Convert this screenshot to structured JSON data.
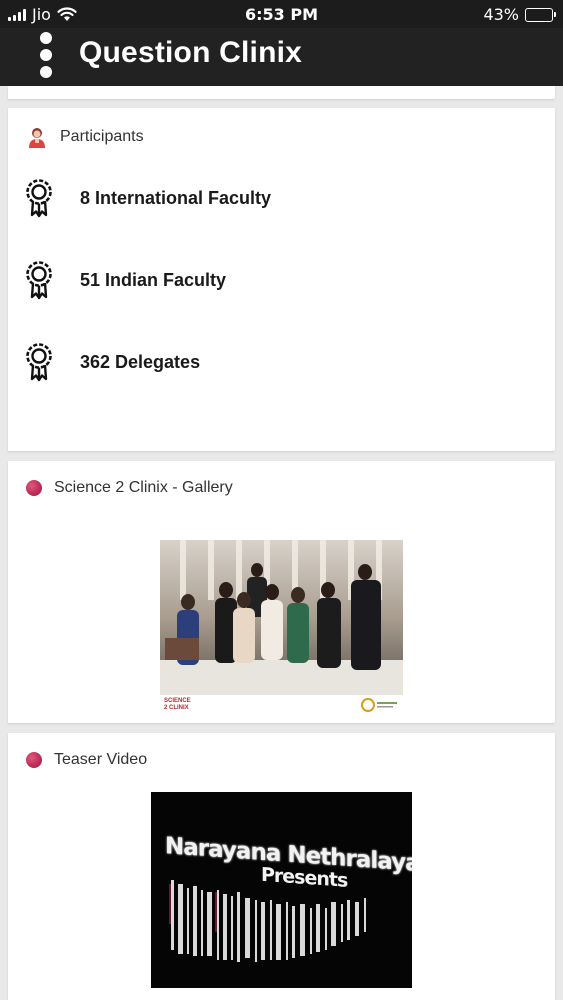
{
  "status_bar": {
    "carrier": "Jio",
    "time": "6:53 PM",
    "battery": "43%",
    "battery_level": 0.43
  },
  "app_bar": {
    "title": "Question Clinix",
    "menu_icon": "more-vertical-icon"
  },
  "participants": {
    "heading": "Participants",
    "heading_icon": "person-avatar-icon",
    "items": [
      {
        "label": "8 International Faculty",
        "icon": "award-ribbon-icon"
      },
      {
        "label": "51 Indian Faculty",
        "icon": "award-ribbon-icon"
      },
      {
        "label": "362 Delegates",
        "icon": "award-ribbon-icon"
      }
    ]
  },
  "gallery": {
    "heading": "Science 2 Clinix - Gallery",
    "heading_icon": "dot-icon",
    "photo_logo_text": "SCIENCE 2 CLINIX"
  },
  "video": {
    "heading": "Teaser Video",
    "heading_icon": "dot-icon",
    "overlay_line1": "Narayana Nethralaya",
    "overlay_line2": "Presents"
  },
  "colors": {
    "app_bar": "#222222",
    "accent_dot": "#c2315a",
    "background": "#e9e9e9"
  }
}
